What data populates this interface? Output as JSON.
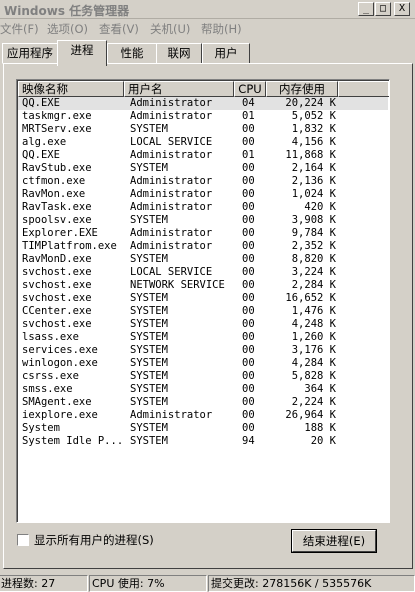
{
  "window": {
    "title": "Windows 任务管理器",
    "minimize": "_",
    "maximize": "□",
    "close": "X"
  },
  "menu": [
    "文件(F)",
    "选项(O)",
    "查看(V)",
    "关机(U)",
    "帮助(H)"
  ],
  "tabs": [
    "应用程序",
    "进程",
    "性能",
    "联网",
    "用户"
  ],
  "active_tab": "进程",
  "columns": {
    "name": "映像名称",
    "user": "用户名",
    "cpu": "CPU",
    "mem": "内存使用"
  },
  "processes": [
    {
      "name": "QQ.EXE",
      "user": "Administrator",
      "cpu": "04",
      "mem": "20,224 K"
    },
    {
      "name": "taskmgr.exe",
      "user": "Administrator",
      "cpu": "01",
      "mem": "5,052 K"
    },
    {
      "name": "MRTServ.exe",
      "user": "SYSTEM",
      "cpu": "00",
      "mem": "1,832 K"
    },
    {
      "name": "alg.exe",
      "user": "LOCAL SERVICE",
      "cpu": "00",
      "mem": "4,156 K"
    },
    {
      "name": "QQ.EXE",
      "user": "Administrator",
      "cpu": "01",
      "mem": "11,868 K"
    },
    {
      "name": "RavStub.exe",
      "user": "SYSTEM",
      "cpu": "00",
      "mem": "2,164 K"
    },
    {
      "name": "ctfmon.exe",
      "user": "Administrator",
      "cpu": "00",
      "mem": "2,136 K"
    },
    {
      "name": "RavMon.exe",
      "user": "Administrator",
      "cpu": "00",
      "mem": "1,024 K"
    },
    {
      "name": "RavTask.exe",
      "user": "Administrator",
      "cpu": "00",
      "mem": "420 K"
    },
    {
      "name": "spoolsv.exe",
      "user": "SYSTEM",
      "cpu": "00",
      "mem": "3,908 K"
    },
    {
      "name": "Explorer.EXE",
      "user": "Administrator",
      "cpu": "00",
      "mem": "9,784 K"
    },
    {
      "name": "TIMPlatfrom.exe",
      "user": "Administrator",
      "cpu": "00",
      "mem": "2,352 K"
    },
    {
      "name": "RavMonD.exe",
      "user": "SYSTEM",
      "cpu": "00",
      "mem": "8,820 K"
    },
    {
      "name": "svchost.exe",
      "user": "LOCAL SERVICE",
      "cpu": "00",
      "mem": "3,224 K"
    },
    {
      "name": "svchost.exe",
      "user": "NETWORK SERVICE",
      "cpu": "00",
      "mem": "2,284 K"
    },
    {
      "name": "svchost.exe",
      "user": "SYSTEM",
      "cpu": "00",
      "mem": "16,652 K"
    },
    {
      "name": "CCenter.exe",
      "user": "SYSTEM",
      "cpu": "00",
      "mem": "1,476 K"
    },
    {
      "name": "svchost.exe",
      "user": "SYSTEM",
      "cpu": "00",
      "mem": "4,248 K"
    },
    {
      "name": "lsass.exe",
      "user": "SYSTEM",
      "cpu": "00",
      "mem": "1,260 K"
    },
    {
      "name": "services.exe",
      "user": "SYSTEM",
      "cpu": "00",
      "mem": "3,176 K"
    },
    {
      "name": "winlogon.exe",
      "user": "SYSTEM",
      "cpu": "00",
      "mem": "4,284 K"
    },
    {
      "name": "csrss.exe",
      "user": "SYSTEM",
      "cpu": "00",
      "mem": "5,828 K"
    },
    {
      "name": "smss.exe",
      "user": "SYSTEM",
      "cpu": "00",
      "mem": "364 K"
    },
    {
      "name": "SMAgent.exe",
      "user": "SYSTEM",
      "cpu": "00",
      "mem": "2,224 K"
    },
    {
      "name": "iexplore.exe",
      "user": "Administrator",
      "cpu": "00",
      "mem": "26,964 K"
    },
    {
      "name": "System",
      "user": "SYSTEM",
      "cpu": "00",
      "mem": "188 K"
    },
    {
      "name": "System Idle P...",
      "user": "SYSTEM",
      "cpu": "94",
      "mem": "20 K"
    }
  ],
  "show_all_users_label": "显示所有用户的进程(S)",
  "show_all_users_checked": false,
  "end_process_label": "结束进程(E)",
  "status": {
    "processes": "进程数: 27",
    "cpu": "CPU 使用: 7%",
    "commit": "提交更改: 278156K / 535576K"
  }
}
